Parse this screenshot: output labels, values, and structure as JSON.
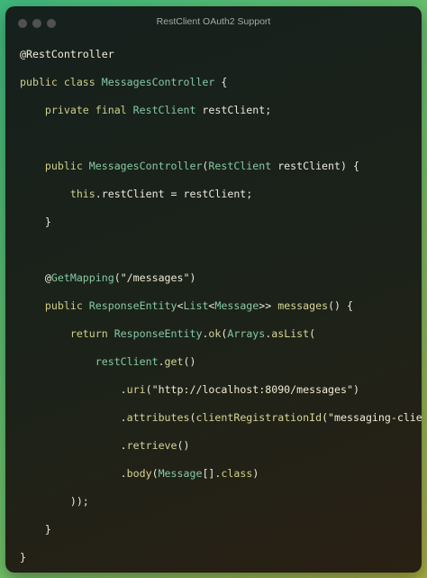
{
  "window": {
    "title": "RestClient OAuth2 Support"
  },
  "code": {
    "lines": [
      [
        {
          "t": "@RestController",
          "c": "an"
        }
      ],
      [
        {
          "t": "public class ",
          "c": "kw"
        },
        {
          "t": "MessagesController",
          "c": "ty"
        },
        {
          "t": " {",
          "c": "pl"
        }
      ],
      [
        {
          "t": "    private final ",
          "c": "kw"
        },
        {
          "t": "RestClient",
          "c": "ty"
        },
        {
          "t": " restClient;",
          "c": "pl"
        }
      ],
      [],
      [
        {
          "t": "    public ",
          "c": "kw"
        },
        {
          "t": "MessagesController",
          "c": "ty"
        },
        {
          "t": "(",
          "c": "pl"
        },
        {
          "t": "RestClient",
          "c": "ty"
        },
        {
          "t": " restClient) {",
          "c": "pl"
        }
      ],
      [
        {
          "t": "        this",
          "c": "kw"
        },
        {
          "t": ".restClient = restClient;",
          "c": "pl"
        }
      ],
      [
        {
          "t": "    }",
          "c": "pl"
        }
      ],
      [],
      [
        {
          "t": "    @",
          "c": "an"
        },
        {
          "t": "GetMapping",
          "c": "ty"
        },
        {
          "t": "(\"/messages\")",
          "c": "st"
        }
      ],
      [
        {
          "t": "    public ",
          "c": "kw"
        },
        {
          "t": "ResponseEntity",
          "c": "ty"
        },
        {
          "t": "<",
          "c": "pl"
        },
        {
          "t": "List",
          "c": "ty"
        },
        {
          "t": "<",
          "c": "pl"
        },
        {
          "t": "Message",
          "c": "ty"
        },
        {
          "t": ">> ",
          "c": "pl"
        },
        {
          "t": "messages",
          "c": "fn"
        },
        {
          "t": "() {",
          "c": "pl"
        }
      ],
      [
        {
          "t": "        return ",
          "c": "kw"
        },
        {
          "t": "ResponseEntity",
          "c": "ty"
        },
        {
          "t": ".",
          "c": "pl"
        },
        {
          "t": "ok",
          "c": "fn"
        },
        {
          "t": "(",
          "c": "pl"
        },
        {
          "t": "Arrays",
          "c": "ty"
        },
        {
          "t": ".",
          "c": "pl"
        },
        {
          "t": "asList",
          "c": "fn"
        },
        {
          "t": "(",
          "c": "pl"
        }
      ],
      [
        {
          "t": "            restClient",
          "c": "ty"
        },
        {
          "t": ".",
          "c": "pl"
        },
        {
          "t": "get",
          "c": "fn"
        },
        {
          "t": "()",
          "c": "pl"
        }
      ],
      [
        {
          "t": "                .",
          "c": "pl"
        },
        {
          "t": "uri",
          "c": "fn"
        },
        {
          "t": "(\"http://localhost:8090/messages\")",
          "c": "st"
        }
      ],
      [
        {
          "t": "                .",
          "c": "pl"
        },
        {
          "t": "attributes",
          "c": "fn"
        },
        {
          "t": "(",
          "c": "pl"
        },
        {
          "t": "clientRegistrationId",
          "c": "fn"
        },
        {
          "t": "(\"messaging-client\"))",
          "c": "st"
        }
      ],
      [
        {
          "t": "                .",
          "c": "pl"
        },
        {
          "t": "retrieve",
          "c": "fn"
        },
        {
          "t": "()",
          "c": "pl"
        }
      ],
      [
        {
          "t": "                .",
          "c": "pl"
        },
        {
          "t": "body",
          "c": "fn"
        },
        {
          "t": "(",
          "c": "pl"
        },
        {
          "t": "Message",
          "c": "ty"
        },
        {
          "t": "[].",
          "c": "pl"
        },
        {
          "t": "class",
          "c": "kw"
        },
        {
          "t": ")",
          "c": "pl"
        }
      ],
      [
        {
          "t": "        ));",
          "c": "pl"
        }
      ],
      [
        {
          "t": "    }",
          "c": "pl"
        }
      ],
      [
        {
          "t": "}",
          "c": "pl"
        }
      ]
    ]
  }
}
